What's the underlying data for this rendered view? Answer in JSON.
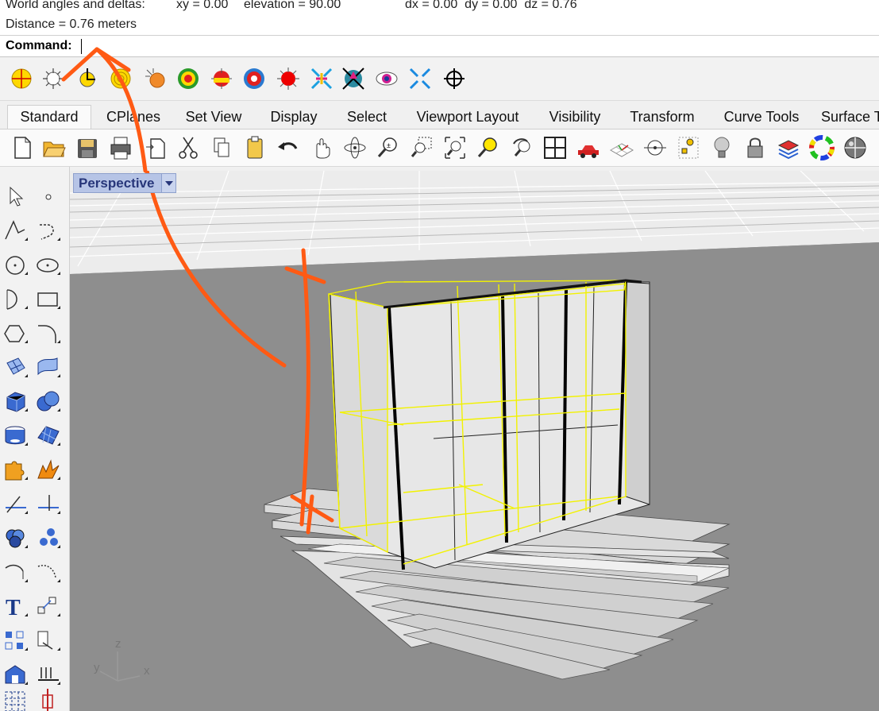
{
  "history": {
    "line1_label": "World angles and deltas:",
    "line1_xy": "xy = 0.00",
    "line1_elevation": "elevation = 90.00",
    "line1_deltas": "dx = 0.00  dy = 0.00  dz = 0.76",
    "line2": "Distance = 0.76 meters"
  },
  "command": {
    "prompt": "Command:",
    "value": ""
  },
  "osnap_icons": [
    "end-snap-icon",
    "near-snap-icon",
    "point-snap-icon",
    "mid-snap-icon",
    "center-snap-icon",
    "intersection-snap-icon",
    "perpendicular-snap-icon",
    "tangent-snap-icon",
    "quad-snap-icon",
    "knot-snap-icon",
    "vertex-snap-icon",
    "project-snap-icon",
    "smarttrack-snap-icon",
    "disable-snap-icon",
    "planar-snap-icon"
  ],
  "tabs": [
    {
      "label": "Standard",
      "active": true
    },
    {
      "label": "CPlanes"
    },
    {
      "label": "Set View"
    },
    {
      "label": "Display"
    },
    {
      "label": "Select"
    },
    {
      "label": "Viewport Layout"
    },
    {
      "label": "Visibility"
    },
    {
      "label": "Transform"
    },
    {
      "label": "Curve Tools"
    },
    {
      "label": "Surface Tools"
    }
  ],
  "viewport": {
    "title": "Perspective",
    "axes": {
      "x": "x",
      "y": "y",
      "z": "z"
    }
  },
  "colors": {
    "selection": "#ffff00",
    "annotation": "#ff5a14",
    "viewport_bg": "#8e8e8e",
    "grid": "#ffffff"
  }
}
